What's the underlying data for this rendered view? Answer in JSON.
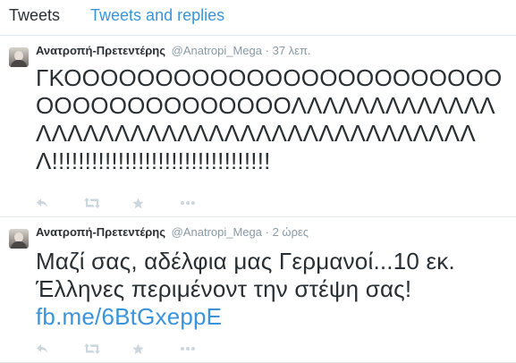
{
  "tabs": [
    {
      "label": "Tweets"
    },
    {
      "label": "Tweets and replies"
    }
  ],
  "tweets": [
    {
      "fullname": "Ανατροπή-Πρετεντέρης",
      "handle": "@Anatropi_Mega",
      "separator": "·",
      "time": "37 λεπ.",
      "text": "ΓΚΟΟΟΟΟΟΟΟΟΟΟΟΟΟΟΟΟΟΟΟΟΟΟΟΟΟΟΟΟΟΟΟΟΟΟΟΟΟΛΛΛΛΛΛΛΛΛΛΛΛΛΛΛΛΛΛΛΛΛΛΛΛΛΛΛΛΛΛΛΛΛΛΛΛΛΛΛΛΛΛ!!!!!!!!!!!!!!!!!!!!!!!!!!!!!!!!!",
      "link": ""
    },
    {
      "fullname": "Ανατροπή-Πρετεντέρης",
      "handle": "@Anatropi_Mega",
      "separator": "·",
      "time": "2 ώρες",
      "text": "Μαζί σας, αδέλφια μας Γερμανοί...10 εκ. Έλληνες περιμένοντ την στέψη σας!",
      "link": "fb.me/6BtGxeppE"
    }
  ],
  "icons": {
    "reply": "reply-icon",
    "retweet": "retweet-icon",
    "favorite": "star-icon",
    "more": "more-icon"
  },
  "colors": {
    "link": "#3b94d9",
    "muted": "#8899a6",
    "icon": "#ccd6dd",
    "border": "#e1e8ed"
  }
}
